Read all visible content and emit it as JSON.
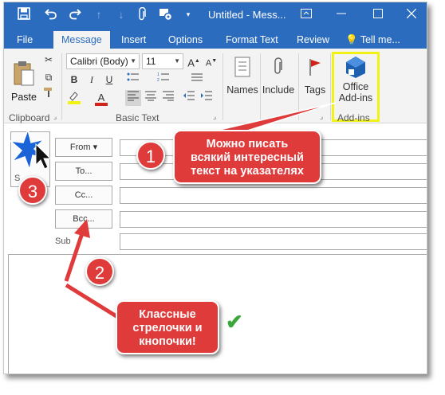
{
  "titlebar": {
    "title": "Untitled - Mess...",
    "quick_access": [
      {
        "icon": "save-icon",
        "glyph": "💾"
      },
      {
        "icon": "undo-icon",
        "glyph": "↶"
      },
      {
        "icon": "redo-icon",
        "glyph": "↷"
      },
      {
        "icon": "up-arrow-icon",
        "glyph": "↑"
      },
      {
        "icon": "down-arrow-icon",
        "glyph": "↓"
      },
      {
        "icon": "attach-icon",
        "glyph": "⎘"
      },
      {
        "icon": "addin-icon",
        "glyph": "⚙"
      }
    ],
    "window_buttons": [
      {
        "icon": "ribbon-display-icon",
        "glyph": "⊡"
      },
      {
        "icon": "minimize-icon",
        "glyph": "—"
      },
      {
        "icon": "maximize-icon",
        "glyph": "☐"
      },
      {
        "icon": "close-icon",
        "glyph": "✕"
      }
    ]
  },
  "tabs": [
    "File",
    "Message",
    "Insert",
    "Options",
    "Format Text",
    "Review",
    "Tell me..."
  ],
  "ribbon": {
    "paste_label": "Paste",
    "clipboard_label": "Clipboard",
    "font_name": "Calibri (Body)",
    "font_size": "11",
    "basic_text_label": "Basic Text",
    "bold": "B",
    "italic": "I",
    "underline": "U",
    "font_color": "A",
    "names_label": "Names",
    "include_label": "Include",
    "tags_label": "Tags",
    "office_label_1": "Office",
    "office_label_2": "Add-ins",
    "addins_group_label": "Add-ins"
  },
  "compose": {
    "from_label": "From ▾",
    "to_label": "To...",
    "cc_label": "Cc...",
    "bcc_label": "Bcc...",
    "send_label": "S",
    "subject_label": "Sub"
  },
  "annotations": {
    "badge_1": "1",
    "badge_2": "2",
    "badge_3": "3",
    "callout_top": [
      "Можно писать",
      "всякий интересный",
      "текст на указателях"
    ],
    "callout_bottom": [
      "Классные",
      "стрелочки и",
      "кнопочки!"
    ],
    "checkmark": "✔"
  },
  "colors": {
    "titlebar": "#2b6cbf",
    "ribbon_bg": "#f3f3f3",
    "annotation_red": "#df3b3b",
    "highlight_yellow": "#f2f215"
  }
}
